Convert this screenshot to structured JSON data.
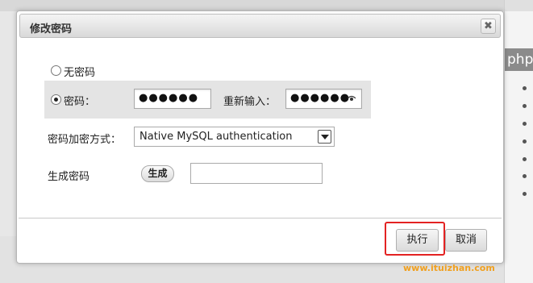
{
  "dialog": {
    "title": "修改密码",
    "close_glyph": "✖"
  },
  "options": {
    "no_password_label": "无密码",
    "password_label": "密码：",
    "password_value": "●●●●●●",
    "reenter_label": "重新输入：",
    "reenter_value": "●●●●●●",
    "selected": "password"
  },
  "hashing": {
    "label": "密码加密方式：",
    "selected": "Native MySQL authentication"
  },
  "generate": {
    "label": "生成密码",
    "button_label": "生成",
    "value": ""
  },
  "footer": {
    "execute_label": "执行",
    "cancel_label": "取消",
    "highlight_color": "#e32222"
  },
  "background": {
    "php_tab": "php"
  },
  "watermark": "www.ituizhan.com"
}
